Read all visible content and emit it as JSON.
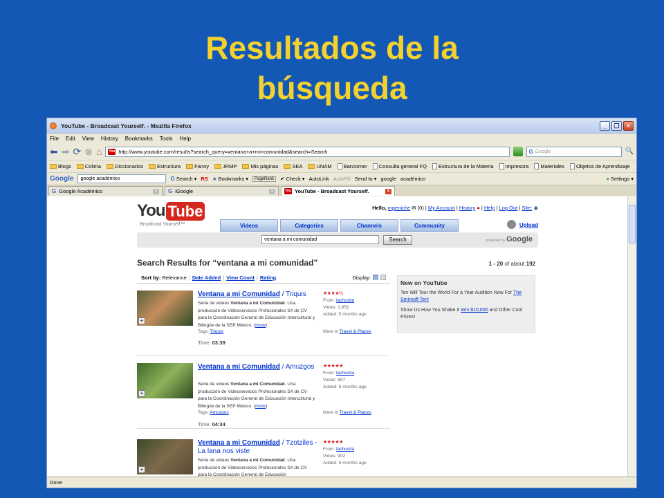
{
  "slide": {
    "title_line1": "Resultados de la",
    "title_line2": "búsqueda"
  },
  "browser": {
    "title": "YouTube - Broadcast Yourself. - Mozilla Firefox",
    "menus": [
      "File",
      "Edit",
      "View",
      "History",
      "Bookmarks",
      "Tools",
      "Help"
    ],
    "url": "http://www.youtube.com/results?search_query=ventana+a+mi+comunidad&search=Search",
    "search_placeholder": "Google",
    "bookmarks": [
      "Blogs",
      "Colima",
      "Diccionarios",
      "Estructura",
      "Fanny",
      "JRMP",
      "Mis páginas",
      "SEA",
      "UNAM",
      "Bancomer",
      "Consulta general FQ",
      "Estructura de la Materia",
      "Impresora",
      "Materiales",
      "Objetos de Aprendizaje"
    ],
    "google_toolbar": {
      "logo": "Google",
      "query": "google académico",
      "search": "Search",
      "rs": "RS",
      "bookmarks": "Bookmarks",
      "pagerank": "PageRank",
      "check": "Check",
      "autolink": "AutoLink",
      "autofill": "AutoFill",
      "sendto": "Send to",
      "google_btn": "google",
      "academico_btn": "académico",
      "settings": "Settings"
    },
    "tabs": [
      {
        "label": "Google Académico"
      },
      {
        "label": "iGoogle"
      },
      {
        "label": "YouTube - Broadcast Yourself."
      }
    ],
    "status": "Done"
  },
  "youtube": {
    "logo_you": "You",
    "logo_tube": "Tube",
    "tagline": "Broadcast Yourself™",
    "hello": "Hello,",
    "username": "mpeniche",
    "msg_count": "(0)",
    "my_account": "My Account",
    "history": "History",
    "help": "Help",
    "logout": "Log Out",
    "site": "Site:",
    "nav": [
      "Videos",
      "Categories",
      "Channels",
      "Community"
    ],
    "upload": "Upload",
    "search_value": "ventana a mi comunidad",
    "search_btn": "Search",
    "powered": "powered by",
    "google": "Google",
    "results_heading": "Search Results for “ventana a mi comunidad”",
    "results_range": "1 - 20",
    "results_of": "of about",
    "results_total": "192",
    "sort_label": "Sort by:",
    "sort_options": [
      "Relevance",
      "Date Added",
      "View Count",
      "Rating"
    ],
    "display_label": "Display:",
    "results": [
      {
        "title": "Ventana a mi Comunidad",
        "subtitle": "/ Triquis",
        "desc1": "Serie de videos",
        "desc_bold": "Ventana a mi Comunidad",
        "desc2": ". Una producción de Videoservicios Profesionales SA de CV para la Coordinación General de Educación Intercultural y Bilingüe de la SEP México. (",
        "more": "more",
        "desc3": ")",
        "tags_label": "Tags:",
        "tag": "Triquis",
        "time_label": "Time:",
        "time": "03:39",
        "stars": "★★★★½",
        "from_label": "From:",
        "from": "lachusita",
        "views_label": "Views:",
        "views": "1,852",
        "added_label": "Added:",
        "added": "5 months ago",
        "more_in": "More in",
        "category": "Travel & Places"
      },
      {
        "title": "Ventana a mi Comunidad",
        "subtitle": "/ Amuzgos",
        "desc1": "Serie de videos",
        "desc_bold": "Ventana a mi Comunidad",
        "desc2": ". Una producción de Videoservicios Profesionales SA de CV para la Coordinación General de Educación Intercultural y Bilingüe de la SEP México. (",
        "more": "more",
        "desc3": ")",
        "tags_label": "Tags:",
        "tag": "Amuzgos",
        "time_label": "Time:",
        "time": "04:34",
        "stars": "★★★★★",
        "from_label": "From:",
        "from": "lachusita",
        "views_label": "Views:",
        "views": "897",
        "added_label": "Added:",
        "added": "5 months ago",
        "more_in": "More in",
        "category": "Travel & Places"
      },
      {
        "title": "Ventana a mi Comunidad",
        "subtitle": "/ Tzotziles - La lana nos viste",
        "desc1": "Serie de videos",
        "desc_bold": "Ventana a mi Comunidad",
        "desc2": ". Una producción de Videoservicios Profesionales SA de CV para la Coordinación General de Educación",
        "more": "",
        "desc3": "",
        "tags_label": "",
        "tag": "",
        "time_label": "",
        "time": "",
        "stars": "★★★★★",
        "from_label": "From:",
        "from": "lachusita",
        "views_label": "Views:",
        "views": "902",
        "added_label": "Added:",
        "added": "5 months ago",
        "more_in": "",
        "category": ""
      }
    ],
    "new_box": {
      "heading": "New on YouTube",
      "item1_text": "Ten Will Tour the World For a Year Audition Now For",
      "item1_link": "The Smirnoff Ten!",
      "item2_text": "Show Us How You Shake It",
      "item2_link": "Win $10,000",
      "item2_rest": "and Other Cool Prizes!"
    }
  }
}
